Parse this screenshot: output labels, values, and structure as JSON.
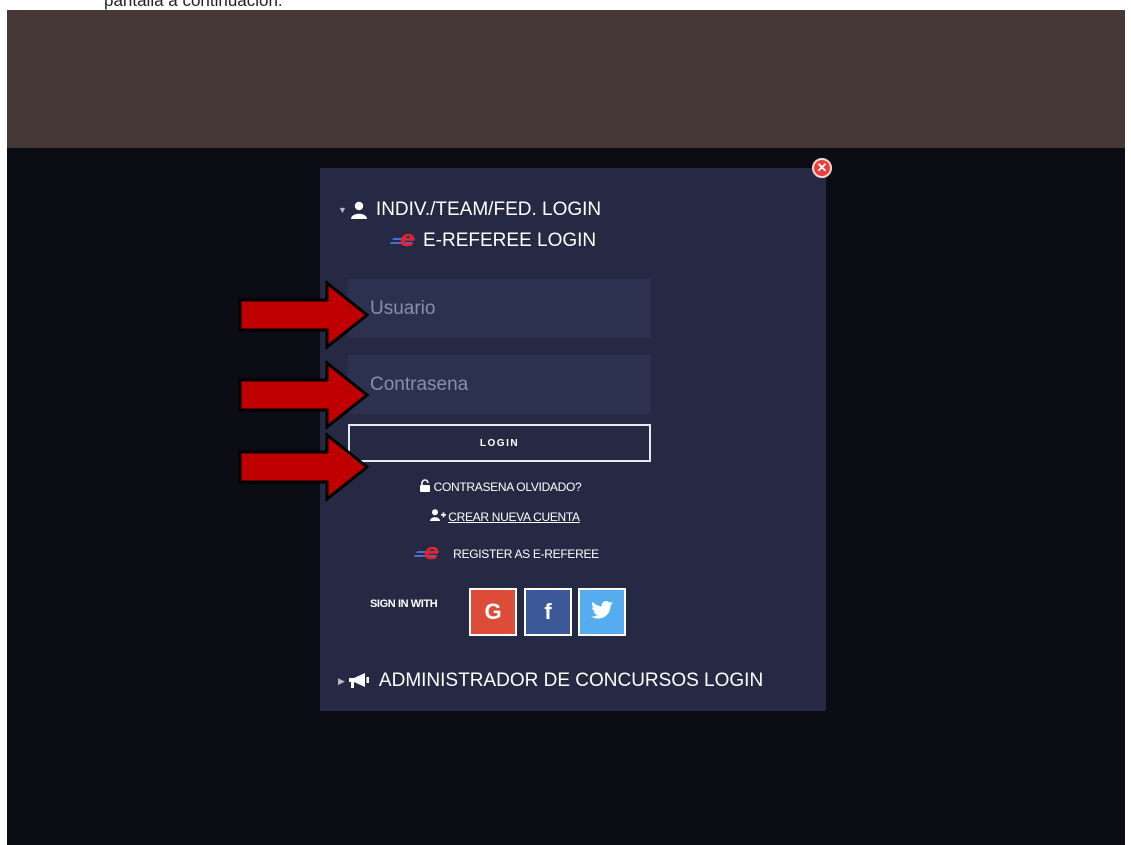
{
  "document": {
    "caption_fragment": "pantalla a continuación."
  },
  "modal": {
    "section_indiv": "INDIV./TEAM/FED. LOGIN",
    "section_ereferee": "E-REFEREE LOGIN",
    "username_placeholder": "Usuario",
    "password_placeholder": "Contrasena",
    "login_label": "LOGIN",
    "forgot_label": "CONTRASENA OLVIDADO?",
    "create_account_label": "CREAR NUEVA CUENTA",
    "register_ereferee_label": "REGISTER AS E-REFEREE",
    "sign_in_with_label": "SIGN IN WITH",
    "social": {
      "google": "G",
      "facebook": "f"
    },
    "section_admin": "ADMINISTRADOR DE CONCURSOS LOGIN"
  },
  "colors": {
    "topbar": "#463837",
    "overlay": "#0c0d14",
    "modal_bg": "#252943",
    "input_bg": "#2c3150",
    "google": "#dd4b39",
    "facebook": "#3b5998",
    "twitter": "#55acee",
    "arrow": "#c00000"
  },
  "icons": [
    "close-icon",
    "user-icon",
    "e-referee-logo",
    "lock-icon",
    "user-plus-icon",
    "megaphone-icon",
    "twitter-bird-icon",
    "red-arrow"
  ]
}
